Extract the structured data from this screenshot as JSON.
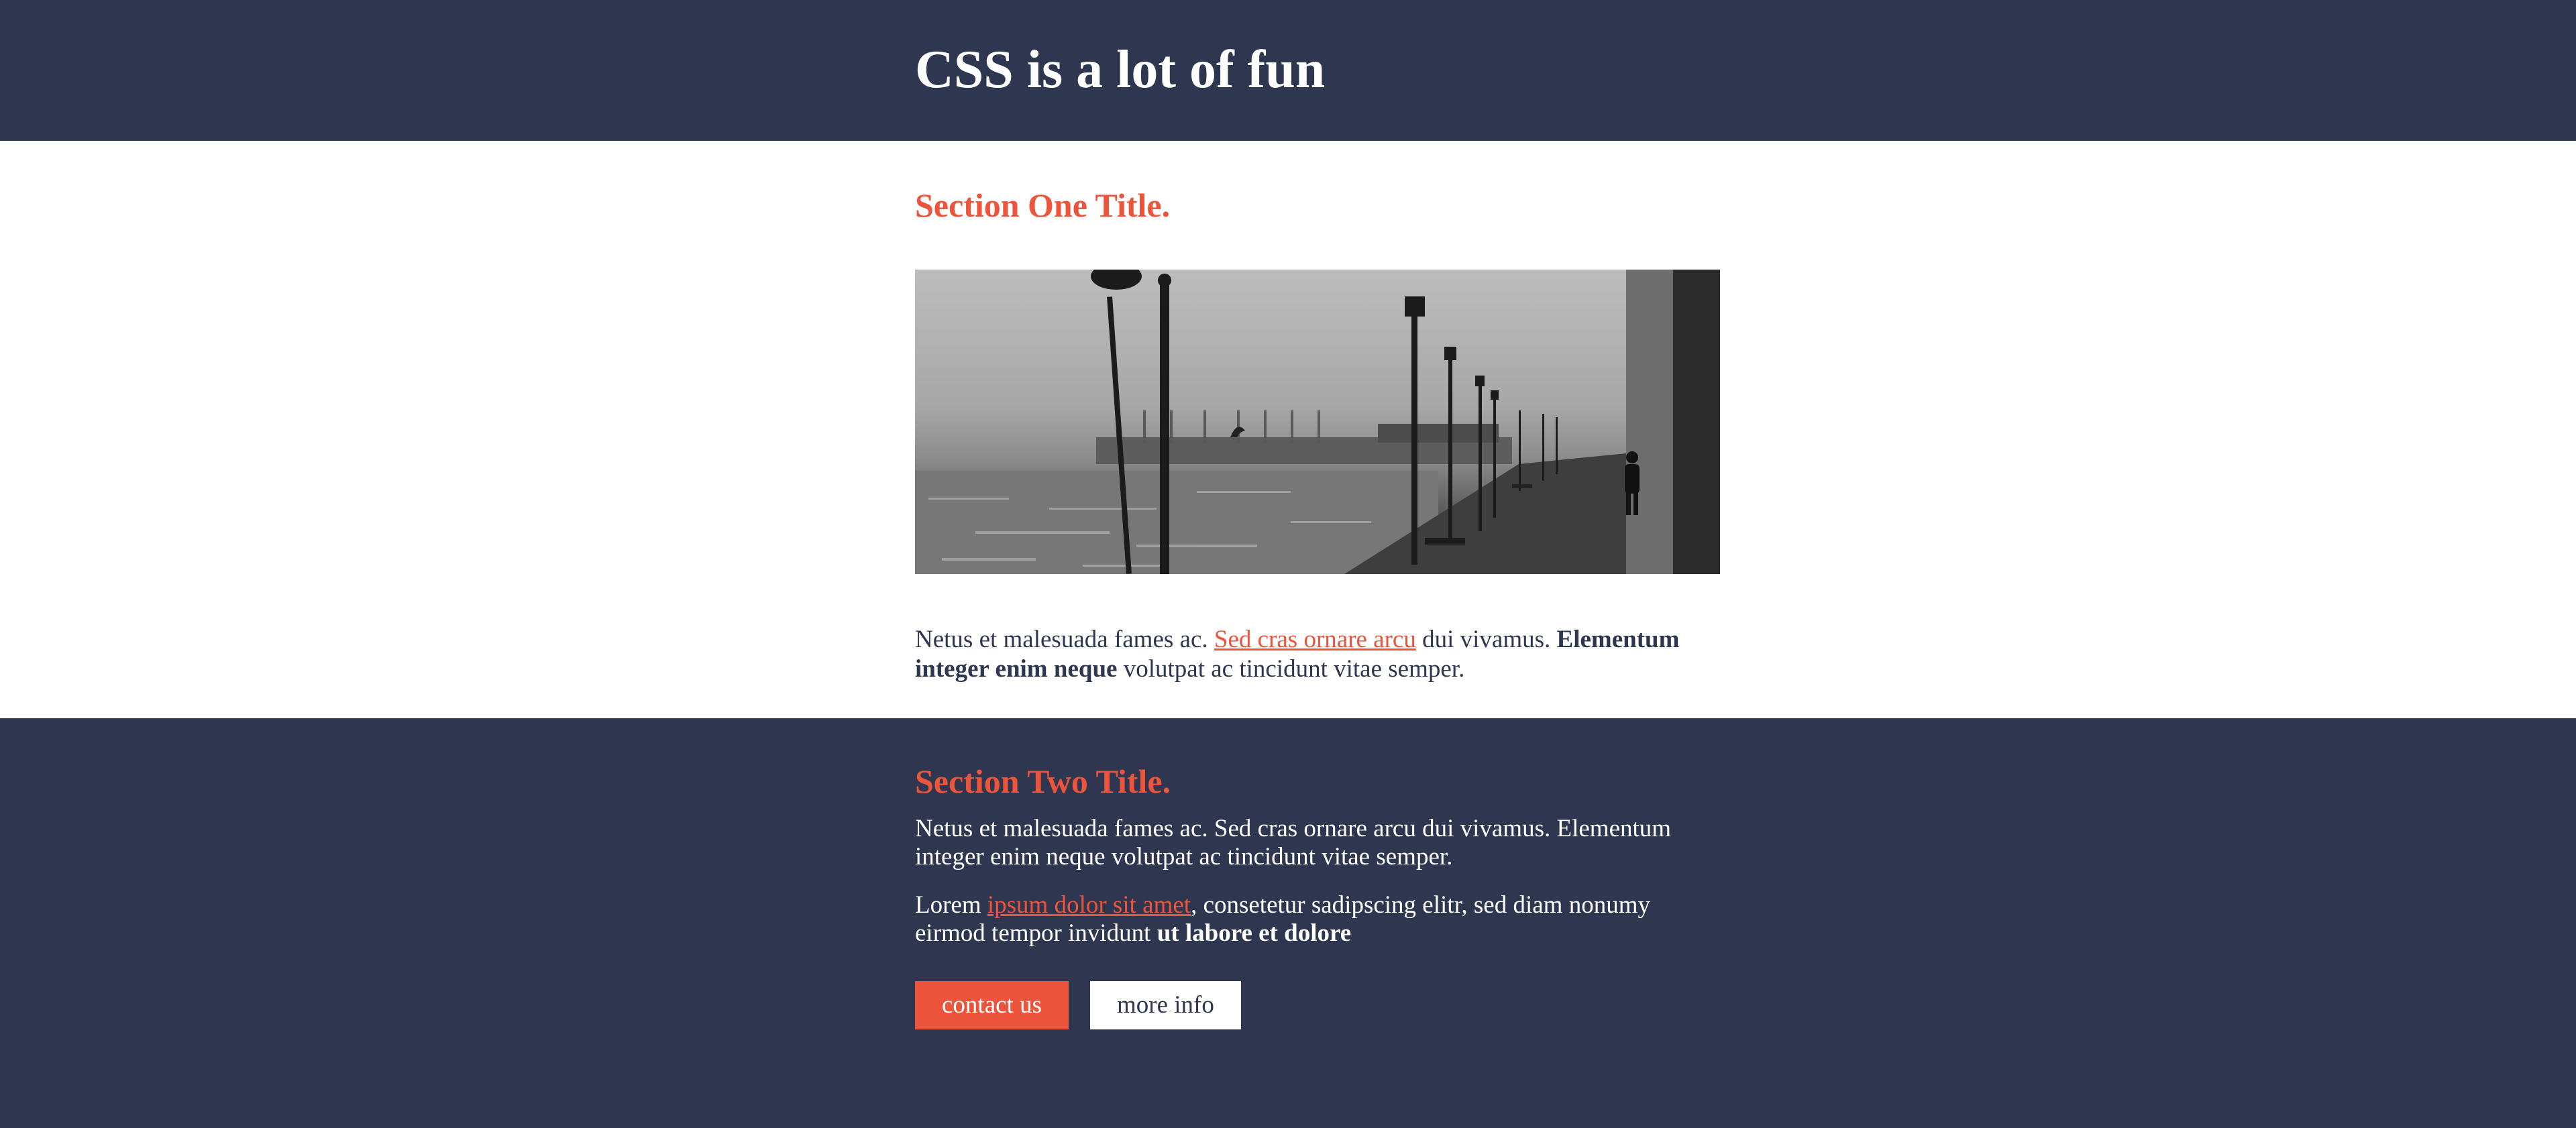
{
  "header": {
    "title": "CSS is a lot of fun"
  },
  "section_one": {
    "title": "Section One Title.",
    "paragraph": {
      "text_1": "Netus et malesuada fames ac. ",
      "link": "Sed cras ornare arcu",
      "text_2": " dui vivamus. ",
      "bold": "Elementum integer enim neque",
      "text_3": " volutpat ac tincidunt vitae semper."
    }
  },
  "section_two": {
    "title": "Section Two Title.",
    "paragraph_1": "Netus et malesuada fames ac. Sed cras ornare arcu dui vivamus. Elementum integer enim neque volutpat ac tincidunt vitae semper.",
    "paragraph_2": {
      "text_1": "Lorem ",
      "link": "ipsum dolor sit amet",
      "text_2": ", consetetur sadipscing elitr, sed diam nonumy eirmod tempor invidunt ",
      "bold": "ut labore et dolore"
    },
    "buttons": {
      "contact": "contact us",
      "more_info": "more info"
    }
  },
  "colors": {
    "navy": "#2e3650",
    "accent": "#ec553c",
    "white": "#ffffff"
  }
}
